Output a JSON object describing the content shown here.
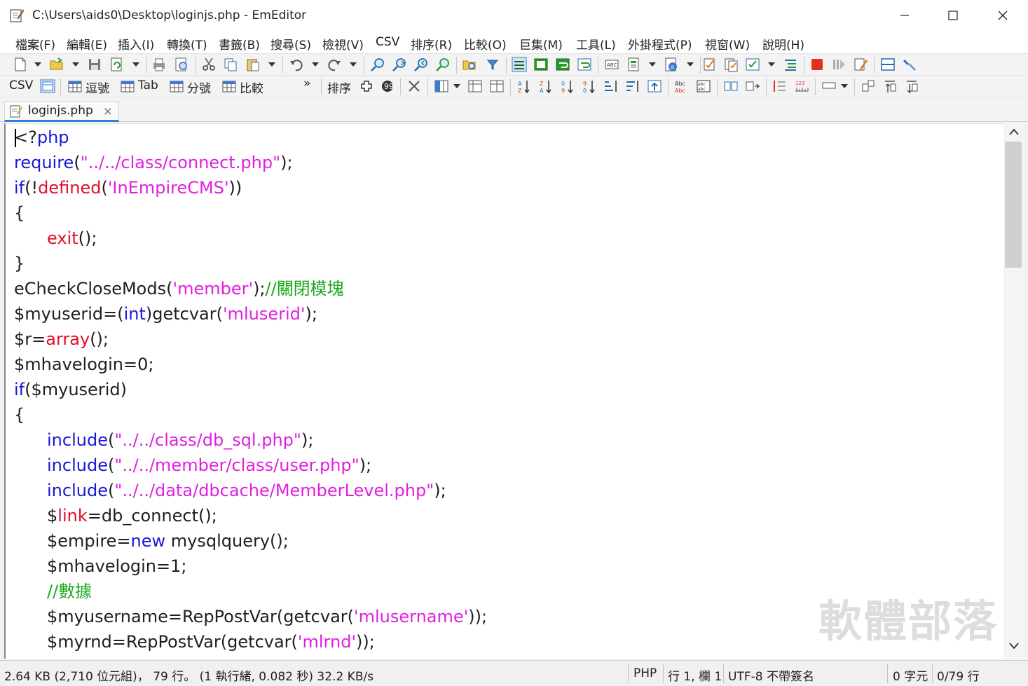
{
  "window": {
    "title": "C:\\Users\\aids0\\Desktop\\loginjs.php - EmEditor"
  },
  "menu": [
    "檔案(F)",
    "編輯(E)",
    "插入(I)",
    "轉換(T)",
    "書籤(B)",
    "搜尋(S)",
    "檢視(V)",
    "CSV",
    "排序(R)",
    "比較(O)",
    "巨集(M)",
    "工具(L)",
    "外掛程式(P)",
    "視窗(W)",
    "說明(H)"
  ],
  "toolbar2": {
    "csv_label": "CSV",
    "comma_label": "逗號",
    "tab_label": "Tab",
    "semicolon_label": "分號",
    "compare_label": "比較",
    "more_label": "»",
    "sort_label": "排序"
  },
  "tab": {
    "label": "loginjs.php",
    "close": "×"
  },
  "code": [
    [
      [
        "tx",
        "<?"
      ],
      [
        "kw",
        "php"
      ]
    ],
    [
      [
        "kw",
        "require"
      ],
      [
        "tx",
        "("
      ],
      [
        "str",
        "\"../../class/connect.php\""
      ],
      [
        "tx",
        ");"
      ]
    ],
    [
      [
        "kw",
        "if"
      ],
      [
        "tx",
        "(!"
      ],
      [
        "fn",
        "defined"
      ],
      [
        "tx",
        "("
      ],
      [
        "str",
        "'InEmpireCMS'"
      ],
      [
        "tx",
        "))"
      ]
    ],
    [
      [
        "tx",
        "{"
      ]
    ],
    [
      [
        "ind",
        ""
      ],
      [
        "fn",
        "exit"
      ],
      [
        "tx",
        "();"
      ]
    ],
    [
      [
        "tx",
        "}"
      ]
    ],
    [
      [
        "tx",
        "eCheckCloseMods("
      ],
      [
        "str",
        "'member'"
      ],
      [
        "tx",
        ");"
      ],
      [
        "cm",
        "//關閉模塊"
      ]
    ],
    [
      [
        "tx",
        "$myuserid=("
      ],
      [
        "kw",
        "int"
      ],
      [
        "tx",
        ")getcvar("
      ],
      [
        "str",
        "'mluserid'"
      ],
      [
        "tx",
        ");"
      ]
    ],
    [
      [
        "tx",
        "$r="
      ],
      [
        "fn",
        "array"
      ],
      [
        "tx",
        "();"
      ]
    ],
    [
      [
        "tx",
        "$mhavelogin=0;"
      ]
    ],
    [
      [
        "kw",
        "if"
      ],
      [
        "tx",
        "($myuserid)"
      ]
    ],
    [
      [
        "tx",
        "{"
      ]
    ],
    [
      [
        "ind",
        ""
      ],
      [
        "kw",
        "include"
      ],
      [
        "tx",
        "("
      ],
      [
        "str",
        "\"../../class/db_sql.php\""
      ],
      [
        "tx",
        ");"
      ]
    ],
    [
      [
        "ind",
        ""
      ],
      [
        "kw",
        "include"
      ],
      [
        "tx",
        "("
      ],
      [
        "str",
        "\"../../member/class/user.php\""
      ],
      [
        "tx",
        ");"
      ]
    ],
    [
      [
        "ind",
        ""
      ],
      [
        "kw",
        "include"
      ],
      [
        "tx",
        "("
      ],
      [
        "str",
        "\"../../data/dbcache/MemberLevel.php\""
      ],
      [
        "tx",
        ");"
      ]
    ],
    [
      [
        "ind",
        ""
      ],
      [
        "tx",
        "$"
      ],
      [
        "fn",
        "link"
      ],
      [
        "tx",
        "=db_connect();"
      ]
    ],
    [
      [
        "ind",
        ""
      ],
      [
        "tx",
        "$empire="
      ],
      [
        "kw",
        "new"
      ],
      [
        "tx",
        " mysqlquery();"
      ]
    ],
    [
      [
        "ind",
        ""
      ],
      [
        "tx",
        "$mhavelogin=1;"
      ]
    ],
    [
      [
        "ind",
        ""
      ],
      [
        "cm",
        "//數據"
      ]
    ],
    [
      [
        "ind",
        ""
      ],
      [
        "tx",
        "$myusername=RepPostVar(getcvar("
      ],
      [
        "str",
        "'mlusername'"
      ],
      [
        "tx",
        "));"
      ]
    ],
    [
      [
        "ind",
        ""
      ],
      [
        "tx",
        "$myrnd=RepPostVar(getcvar("
      ],
      [
        "str",
        "'mlrnd'"
      ],
      [
        "tx",
        "));"
      ]
    ]
  ],
  "watermark": "軟體部落",
  "status": {
    "size": "2.64 KB (2,710 位元組)， 79 行。 (1 執行緒, 0.082 秒) 32.2 KB/s",
    "language": "PHP",
    "position": "行 1, 欄 1",
    "encoding": "UTF-8 不帶簽名",
    "chars": "0 字元",
    "lines": "0/79 行"
  },
  "colors": {
    "keyword": "#1818d8",
    "function": "#e0102a",
    "string": "#e020e0",
    "comment": "#1aa81a",
    "tab_accent": "#2f7fd8"
  }
}
